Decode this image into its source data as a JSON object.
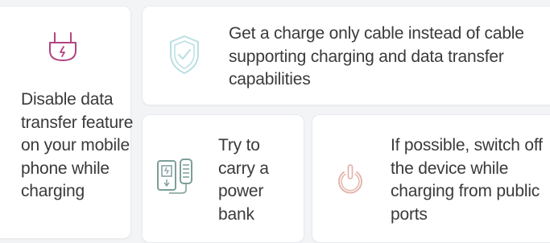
{
  "tips": {
    "disable": {
      "text": "Disable data transfer feature on your mobile phone while charging",
      "icon": "plug-icon",
      "color": "#b2457f"
    },
    "cable": {
      "text": "Get a charge only cable instead of cable supporting charging and data transfer capabilities",
      "icon": "shield-check-icon",
      "color": "#b9dfe3"
    },
    "powerbank": {
      "text": "Try to carry a power bank",
      "icon": "power-bank-icon",
      "color": "#7c9e9a"
    },
    "switch_off": {
      "text": "If possible, switch off the device while charging from public ports",
      "icon": "power-icon",
      "color": "#e3b6ad"
    }
  }
}
